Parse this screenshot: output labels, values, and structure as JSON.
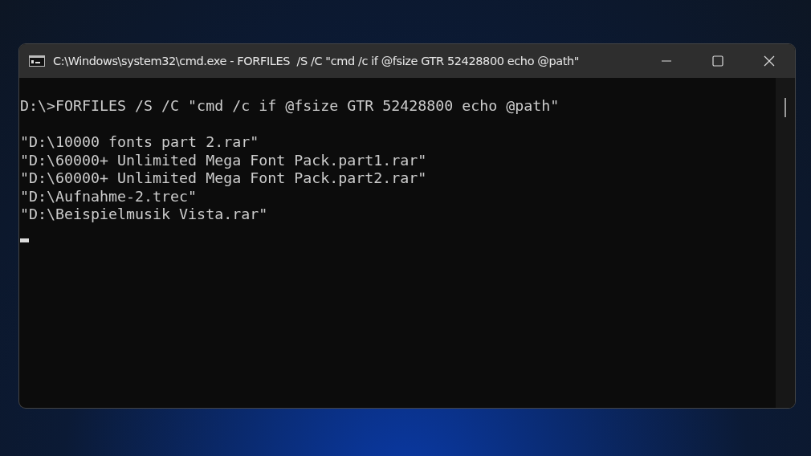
{
  "window": {
    "title": "C:\\Windows\\system32\\cmd.exe - FORFILES  /S /C \"cmd /c if @fsize GTR 52428800 echo @path\""
  },
  "console": {
    "command": "D:\\>FORFILES /S /C \"cmd /c if @fsize GTR 52428800 echo @path\"",
    "output": [
      "\"D:\\10000 fonts part 2.rar\"",
      "\"D:\\60000+ Unlimited Mega Font Pack.part1.rar\"",
      "\"D:\\60000+ Unlimited Mega Font Pack.part2.rar\"",
      "\"D:\\Aufnahme-2.trec\"",
      "\"D:\\Beispielmusik Vista.rar\""
    ]
  }
}
